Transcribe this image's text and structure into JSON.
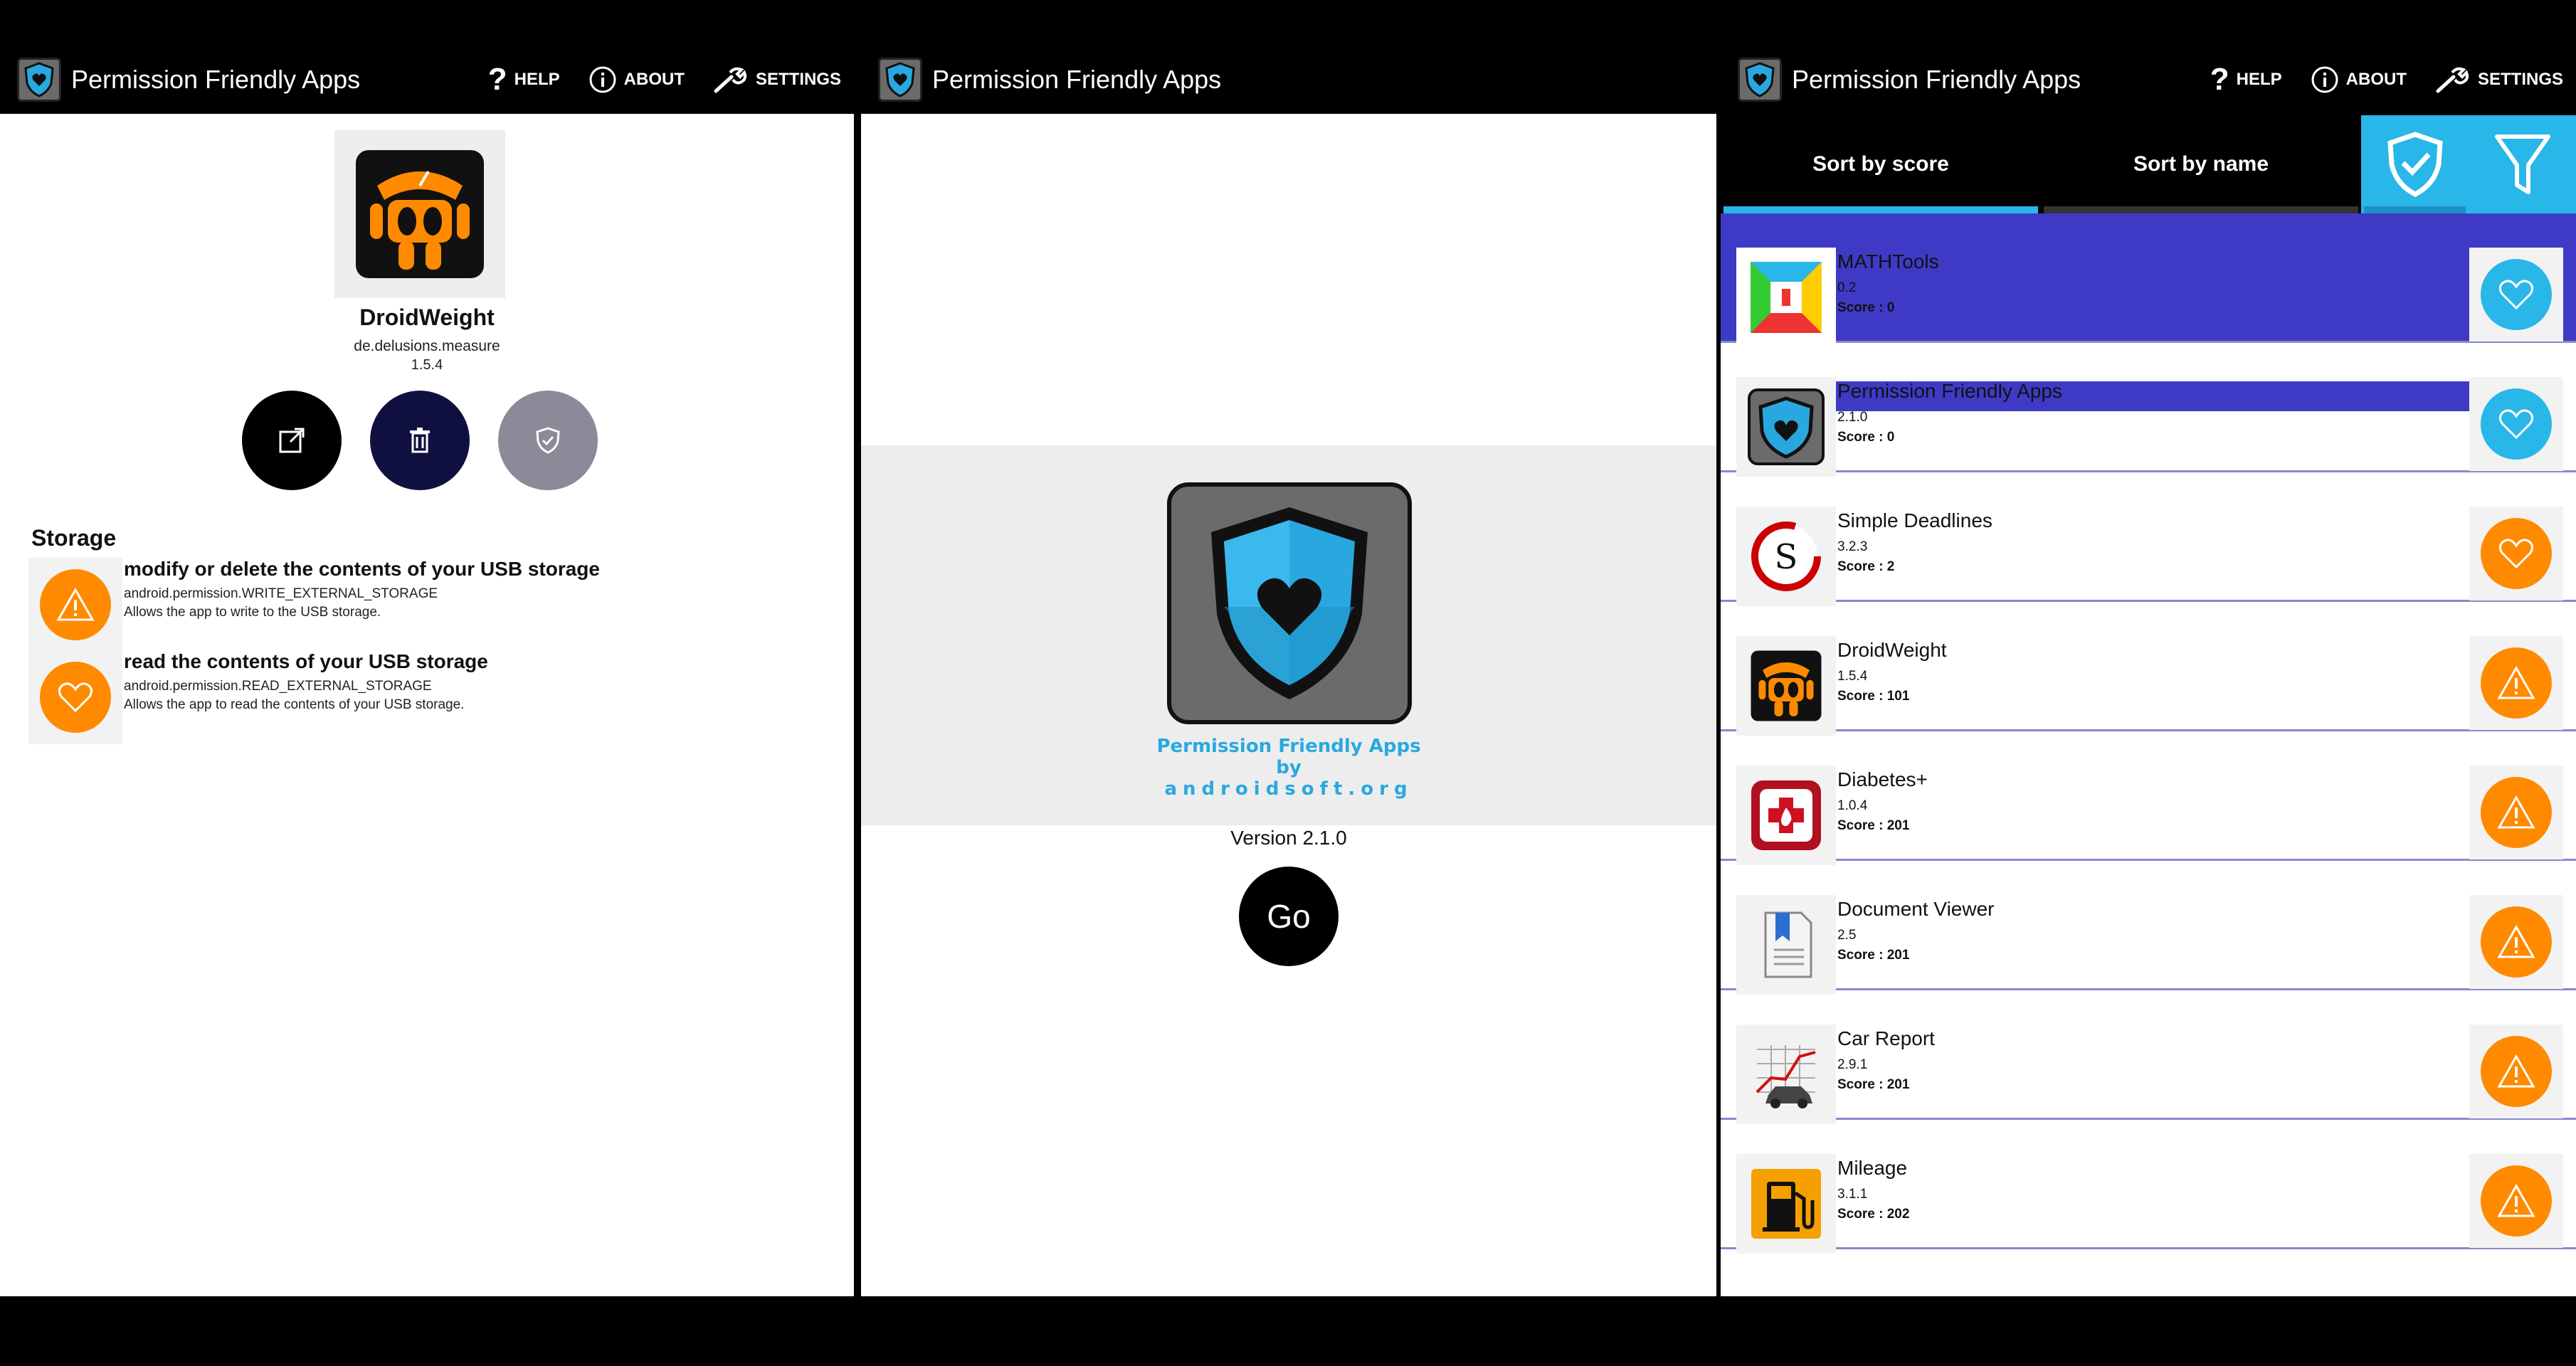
{
  "app": {
    "title": "Permission Friendly Apps",
    "actions": {
      "help": "HELP",
      "about": "ABOUT",
      "settings": "SETTINGS"
    }
  },
  "detail": {
    "app_name": "DroidWeight",
    "package": "de.delusions.measure",
    "version": "1.5.4",
    "section_title": "Storage",
    "permissions": [
      {
        "title": "modify or delete the contents of your USB storage",
        "name": "android.permission.WRITE_EXTERNAL_STORAGE",
        "description": "Allows the app to write to the USB storage.",
        "icon": "warning-icon"
      },
      {
        "title": "read the contents of your USB storage",
        "name": "android.permission.READ_EXTERNAL_STORAGE",
        "description": "Allows the app to read the contents of your USB storage.",
        "icon": "heart-icon"
      }
    ]
  },
  "splash": {
    "line1": "Permission Friendly Apps",
    "line2": "by",
    "line3": "androidsoft.org",
    "version": "Version 2.1.0",
    "go": "Go"
  },
  "list": {
    "tabs": {
      "sort_score": "Sort by score",
      "sort_name": "Sort by name"
    },
    "score_prefix": "Score : ",
    "apps": [
      {
        "name": "MATHTools",
        "version": "0.2",
        "score": "Score : 0",
        "status": "heart-icon",
        "status_color": "#29b6e8"
      },
      {
        "name": "Permission Friendly Apps",
        "version": "2.1.0",
        "score": "Score : 0",
        "status": "heart-icon",
        "status_color": "#29b6e8"
      },
      {
        "name": "Simple Deadlines",
        "version": "3.2.3",
        "score": "Score : 2",
        "status": "heart-icon",
        "status_color": "#ff8a00"
      },
      {
        "name": "DroidWeight",
        "version": "1.5.4",
        "score": "Score : 101",
        "status": "warning-icon",
        "status_color": "#ff8a00"
      },
      {
        "name": "Diabetes+",
        "version": "1.0.4",
        "score": "Score : 201",
        "status": "warning-icon",
        "status_color": "#ff8a00"
      },
      {
        "name": "Document Viewer",
        "version": "2.5",
        "score": "Score : 201",
        "status": "warning-icon",
        "status_color": "#ff8a00"
      },
      {
        "name": "Car Report",
        "version": "2.9.1",
        "score": "Score : 201",
        "status": "warning-icon",
        "status_color": "#ff8a00"
      },
      {
        "name": "Mileage",
        "version": "3.1.1",
        "score": "Score : 202",
        "status": "warning-icon",
        "status_color": "#ff8a00"
      }
    ]
  },
  "colors": {
    "accent_blue": "#29b6e8",
    "warning_orange": "#ff8a00",
    "selection_purple": "#3f3ac6",
    "dark_navy": "#101040"
  }
}
